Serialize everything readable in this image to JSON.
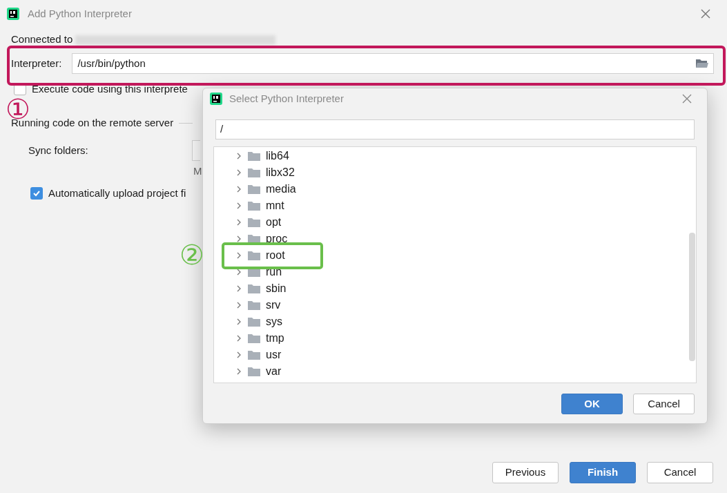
{
  "window": {
    "title": "Add Python Interpreter"
  },
  "connected_label": "Connected to",
  "interpreter": {
    "label": "Interpreter:",
    "value": "/usr/bin/python"
  },
  "execute_checkbox": {
    "label": "Execute code using this interprete",
    "checked": false
  },
  "section_title": "Running code on the remote server",
  "sync_folders": {
    "label": "Sync folders:",
    "hint": "M"
  },
  "upload_checkbox": {
    "label": "Automatically upload project fi",
    "checked": true
  },
  "buttons": [
    {
      "label": "Previous",
      "primary": false
    },
    {
      "label": "Finish",
      "primary": true
    },
    {
      "label": "Cancel",
      "primary": false
    }
  ],
  "dialog": {
    "title": "Select Python Interpreter",
    "path": "/",
    "tree": [
      {
        "name": "lib64",
        "expanded": false
      },
      {
        "name": "libx32",
        "expanded": false
      },
      {
        "name": "media",
        "expanded": false
      },
      {
        "name": "mnt",
        "expanded": false
      },
      {
        "name": "opt",
        "expanded": false
      },
      {
        "name": "proc",
        "expanded": false
      },
      {
        "name": "root",
        "expanded": false,
        "highlighted": true
      },
      {
        "name": "run",
        "expanded": false
      },
      {
        "name": "sbin",
        "expanded": false
      },
      {
        "name": "srv",
        "expanded": false
      },
      {
        "name": "sys",
        "expanded": false
      },
      {
        "name": "tmp",
        "expanded": false
      },
      {
        "name": "usr",
        "expanded": false
      },
      {
        "name": "var",
        "expanded": false
      }
    ],
    "buttons": [
      {
        "label": "OK",
        "primary": true
      },
      {
        "label": "Cancel",
        "primary": false
      }
    ]
  },
  "annotations": [
    {
      "label": "①",
      "color": "#c2185b"
    },
    {
      "label": "②",
      "color": "#6abf4b"
    }
  ]
}
